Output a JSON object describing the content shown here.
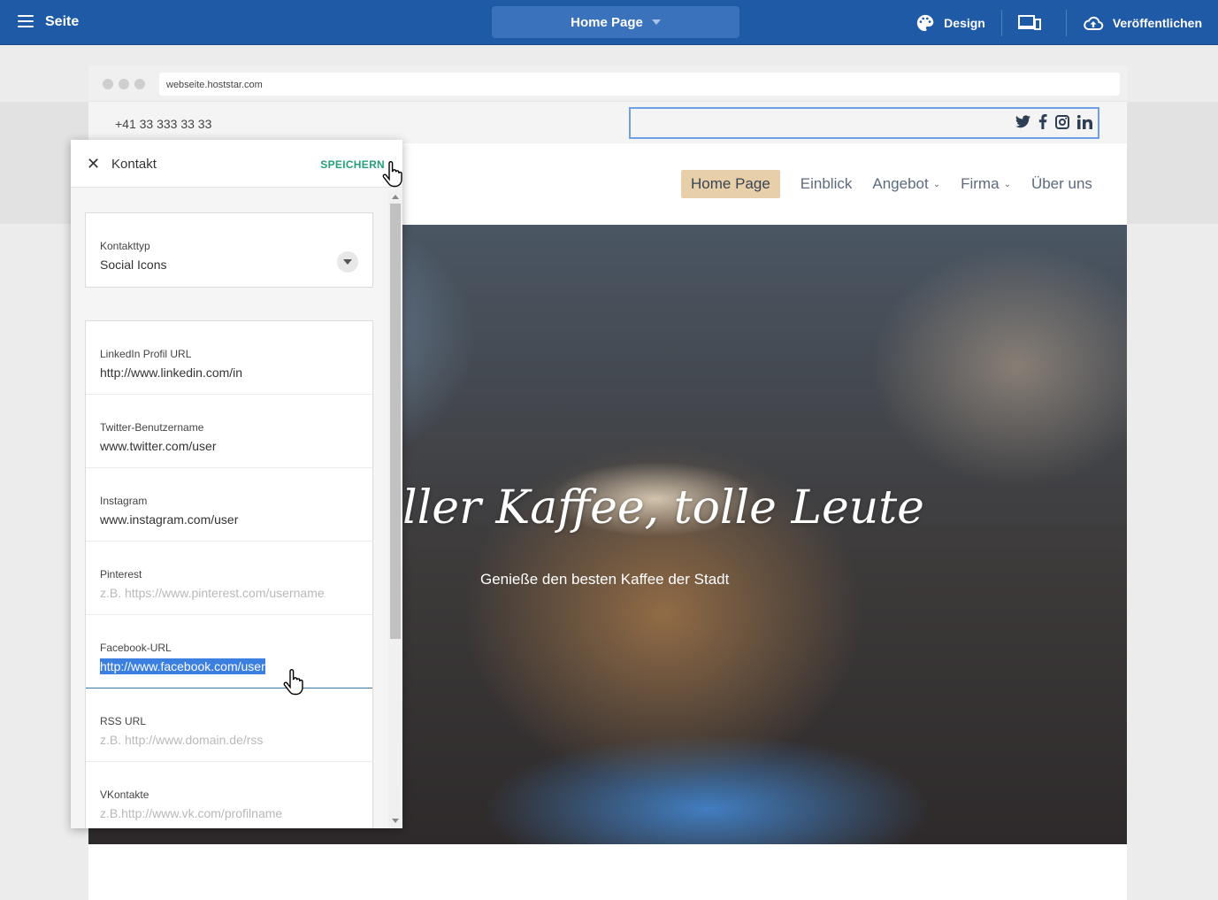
{
  "appbar": {
    "section_label": "Seite",
    "page_selector": "Home Page",
    "design_label": "Design",
    "publish_label": "Veröffentlichen"
  },
  "browser": {
    "url": "webseite.hoststar.com"
  },
  "site": {
    "phone": "+41 33 333 33 33",
    "social_icons": [
      "twitter-icon",
      "facebook-icon",
      "instagram-icon",
      "linkedin-icon"
    ],
    "nav": [
      "Home Page",
      "Einblick",
      "Angebot",
      "Firma",
      "Über uns"
    ],
    "hero_title": "ller Kaffee, tolle Leute",
    "hero_subtitle": "Genieße den besten Kaffee der Stadt"
  },
  "panel": {
    "title": "Kontakt",
    "save_label": "SPEICHERN",
    "contact_type": {
      "label": "Kontakttyp",
      "value": "Social Icons"
    },
    "fields": [
      {
        "label": "LinkedIn Profil URL",
        "value": "http://www.linkedin.com/in",
        "placeholder": ""
      },
      {
        "label": "Twitter-Benutzername",
        "value": "www.twitter.com/user",
        "placeholder": ""
      },
      {
        "label": "Instagram",
        "value": "www.instagram.com/user",
        "placeholder": ""
      },
      {
        "label": "Pinterest",
        "value": "",
        "placeholder": "z.B. https://www.pinterest.com/username"
      },
      {
        "label": "Facebook-URL",
        "value": "http://www.facebook.com/user",
        "placeholder": ""
      },
      {
        "label": "RSS URL",
        "value": "",
        "placeholder": "z.B. http://www.domain.de/rss"
      },
      {
        "label": "VKontakte",
        "value": "",
        "placeholder": "z.B.http://www.vk.com/profilname"
      }
    ]
  },
  "colors": {
    "appbar": "#1f5aa6",
    "accent_save": "#26a07a",
    "nav_active": "#e6cfa9",
    "selection": "#3b7fe0"
  }
}
